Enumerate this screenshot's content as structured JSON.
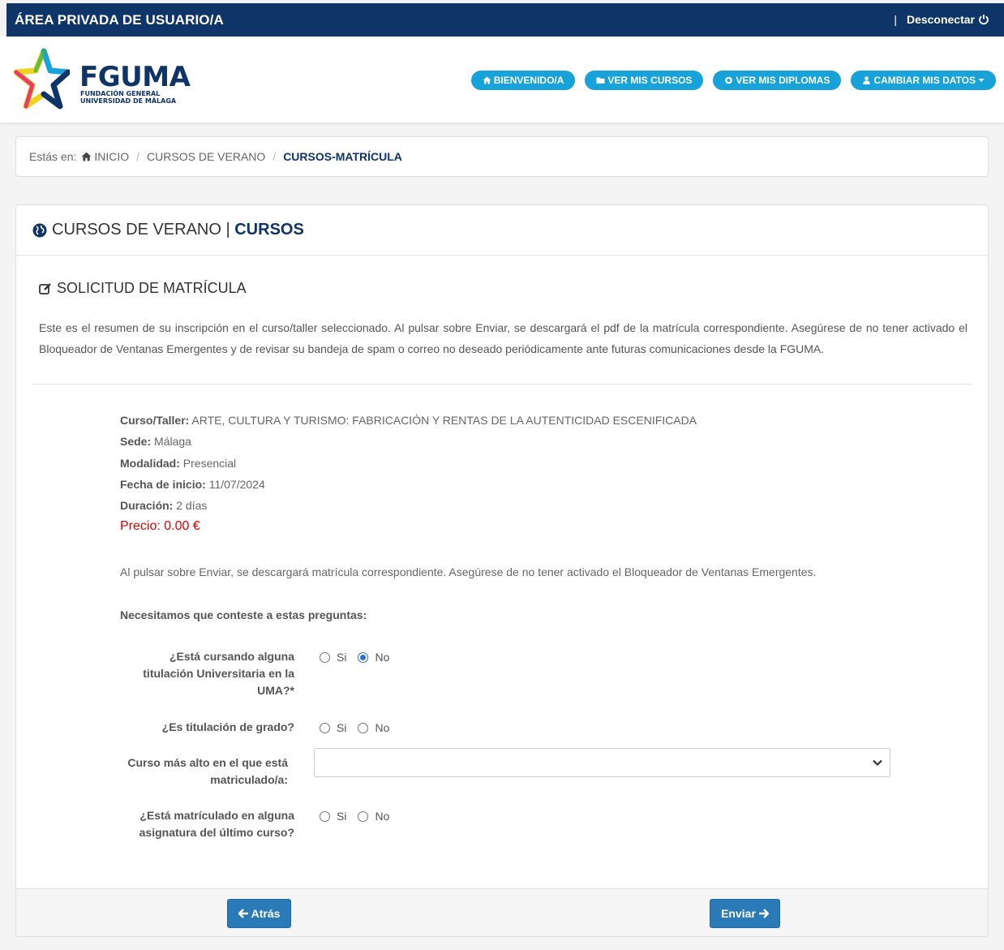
{
  "topbar": {
    "title": "ÁREA PRIVADA DE USUARIO/A",
    "separator": "|",
    "logout": "Desconectar"
  },
  "logo": {
    "brand": "FGUMA",
    "sub1": "FUNDACIÓN GENERAL",
    "sub2": "UNIVERSIDAD DE MÁLAGA"
  },
  "nav": [
    {
      "label": "BIENVENIDO/A",
      "icon": "home-icon"
    },
    {
      "label": "VER MIS CURSOS",
      "icon": "folder-icon"
    },
    {
      "label": "VER MIS DIPLOMAS",
      "icon": "certificate-icon"
    },
    {
      "label": "CAMBIAR MIS DATOS",
      "icon": "user-icon"
    }
  ],
  "breadcrumb": {
    "prefix": "Estás en:",
    "home": "INICIO",
    "level1": "CURSOS DE VERANO",
    "current": "CURSOS-MATRÍCULA"
  },
  "panel": {
    "title_a": "CURSOS DE VERANO | ",
    "title_b": "CURSOS"
  },
  "section": {
    "title": "SOLICITUD DE MATRÍCULA",
    "intro": "Este es el resumen de su inscripción en el curso/taller seleccionado. Al pulsar sobre Enviar, se descargará el pdf de la matrícula correspondiente. Asegúrese de no tener activado el Bloqueador de Ventanas Emergentes y de revisar su bandeja de spam o correo no deseado periódicamente ante futuras comunicaciones desde la FGUMA."
  },
  "summary": {
    "course_label": "Curso/Taller:",
    "course_value": " ARTE, CULTURA Y TURISMO: FABRICACIÓN Y RENTAS DE LA AUTENTICIDAD ESCENIFICADA",
    "venue_label": "Sede:",
    "venue_value": " Málaga",
    "mode_label": "Modalidad:",
    "mode_value": " Presencial",
    "start_label": "Fecha de inicio:",
    "start_value": " 11/07/2024",
    "duration_label": "Duración:",
    "duration_value": " 2 días",
    "price_label": "Precio:",
    "price_value": " 0.00 €"
  },
  "note": "Al pulsar sobre Enviar, se descargará matrícula correspondiente. Asegúrese de no tener activado el Bloqueador de Ventanas Emergentes.",
  "questions_intro": "Necesitamos que conteste a estas preguntas:",
  "questions": {
    "q1_l1": "¿Está cursando alguna",
    "q1_l2": "titulación Universitaria en la",
    "q1_l3": "UMA?*",
    "q2": "¿Es titulación de grado?",
    "q3_l1": "Curso más alto en el que está",
    "q3_l2": "matriculado/a:",
    "q4_l1": "¿Está matrículado en alguna",
    "q4_l2": "asignatura del último curso?",
    "yes": "Si",
    "no": "No",
    "q1_selected": "No",
    "q3_value": ""
  },
  "buttons": {
    "back": "Atrás",
    "send": "Enviar"
  },
  "colors": {
    "navy": "#0f3467",
    "accent": "#17a2d9",
    "button": "#2a7ab8",
    "price": "#e00000"
  }
}
